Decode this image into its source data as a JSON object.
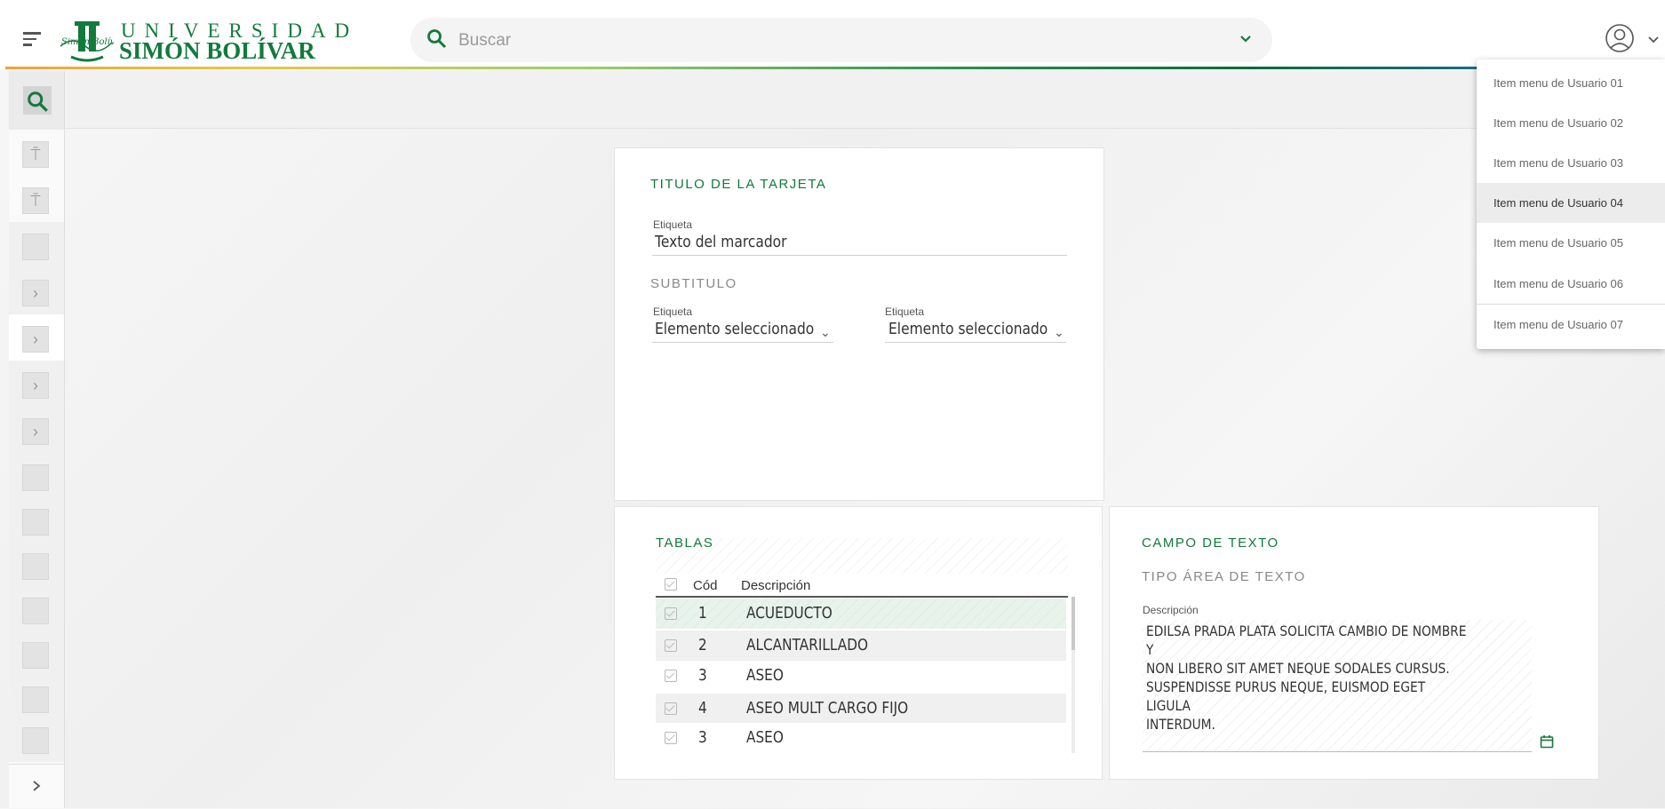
{
  "header": {
    "logo_line1": "UNIVERSIDAD",
    "logo_line2": "SIMÓN BOLÍVAR",
    "logo_script": "Simón Bolívar",
    "search_placeholder": "Buscar"
  },
  "user_menu": {
    "items": [
      "Item menu de Usuario 01",
      "Item menu de Usuario 02",
      "Item menu de Usuario 03",
      "Item menu de Usuario 04",
      "Item menu de Usuario 05",
      "Item menu de Usuario 06",
      "Item menu de Usuario 07"
    ],
    "active_index": 3
  },
  "card1": {
    "title": "TITULO DE LA  TARJETA",
    "field1_label": "Etiqueta",
    "field1_value": "Texto del marcador",
    "subtitle": "SUBTITULO",
    "select1_label": "Etiqueta",
    "select1_value": "Elemento seleccionado",
    "select2_label": "Etiqueta",
    "select2_value": "Elemento seleccionado"
  },
  "tables": {
    "title": "TABLAS",
    "columns": [
      "Cód",
      "Descripción"
    ],
    "rows": [
      {
        "cod": "1",
        "desc": "ACUEDUCTO"
      },
      {
        "cod": "2",
        "desc": "ALCANTARILLADO"
      },
      {
        "cod": "3",
        "desc": "ASEO"
      },
      {
        "cod": "4",
        "desc": "ASEO MULT CARGO FIJO"
      },
      {
        "cod": "3",
        "desc": "ASEO"
      }
    ]
  },
  "textfield": {
    "title": "CAMPO DE TEXTO",
    "subtitle": "TIPO ÁREA DE TEXTO",
    "label": "Descripción",
    "value": "EDILSA PRADA PLATA SOLICITA CAMBIO DE NOMBRE Y\nNON LIBERO SIT AMET NEQUE SODALES CURSUS.\nSUSPENDISSE PURUS NEQUE, EUISMOD EGET LIGULA\nINTERDUM."
  },
  "colors": {
    "brand_green": "#127a3d",
    "accent_gradient": [
      "#f2a23a",
      "#9ccf6a",
      "#1f8a4c",
      "#2a6fb5"
    ]
  }
}
